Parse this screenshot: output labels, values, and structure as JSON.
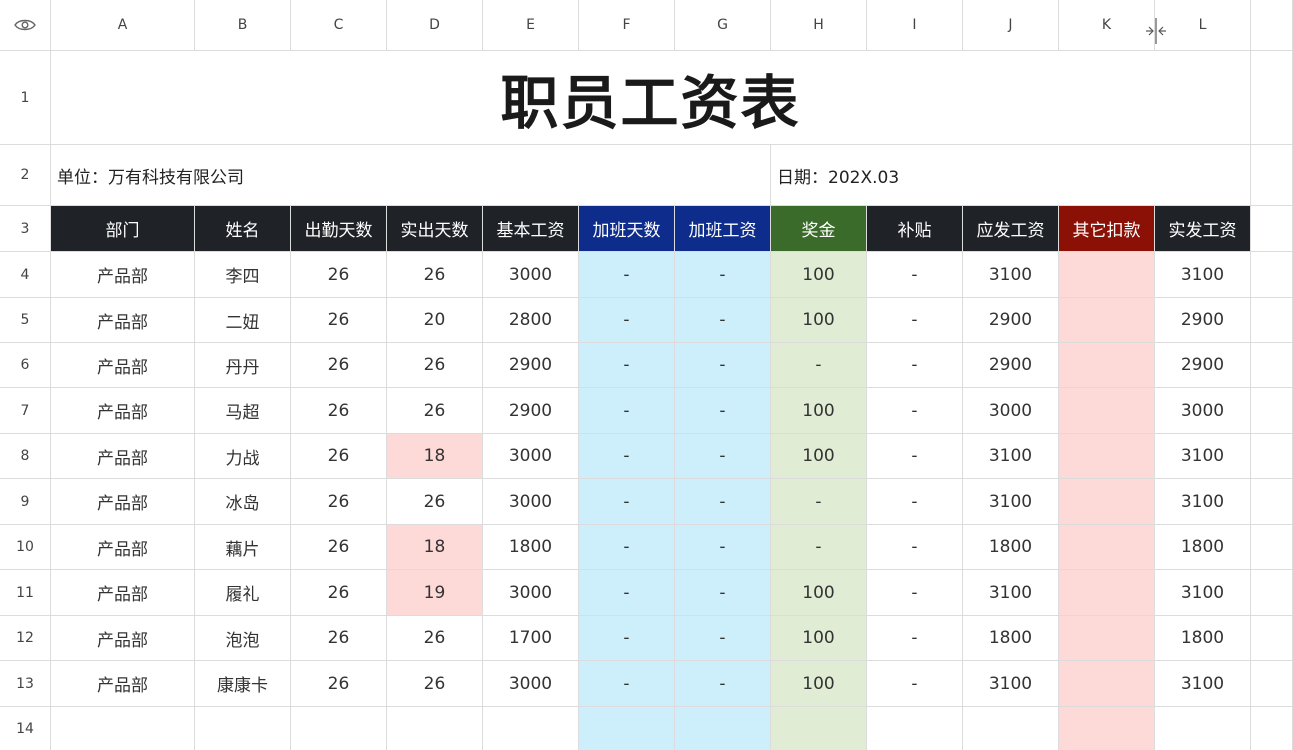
{
  "sheet": {
    "columns": [
      "A",
      "B",
      "C",
      "D",
      "E",
      "F",
      "G",
      "H",
      "I",
      "J",
      "K",
      "L"
    ],
    "rows": [
      "1",
      "2",
      "3",
      "4",
      "5",
      "6",
      "7",
      "8",
      "9",
      "10",
      "11",
      "12",
      "13",
      "14"
    ],
    "title": "职员工资表",
    "unit": "单位：万有科技有限公司",
    "date": "日期：202X.03",
    "headers": [
      "部门",
      "姓名",
      "出勤天数",
      "实出天数",
      "基本工资",
      "加班天数",
      "加班工资",
      "奖金",
      "补贴",
      "应发工资",
      "其它扣款",
      "实发工资"
    ],
    "records": [
      [
        "产品部",
        "李四",
        "26",
        "26",
        "3000",
        "-",
        "-",
        "100",
        "-",
        "3100",
        "",
        "3100"
      ],
      [
        "产品部",
        "二妞",
        "26",
        "20",
        "2800",
        "-",
        "-",
        "100",
        "-",
        "2900",
        "",
        "2900"
      ],
      [
        "产品部",
        "丹丹",
        "26",
        "26",
        "2900",
        "-",
        "-",
        "-",
        "-",
        "2900",
        "",
        "2900"
      ],
      [
        "产品部",
        "马超",
        "26",
        "26",
        "2900",
        "-",
        "-",
        "100",
        "-",
        "3000",
        "",
        "3000"
      ],
      [
        "产品部",
        "力战",
        "26",
        "18",
        "3000",
        "-",
        "-",
        "100",
        "-",
        "3100",
        "",
        "3100"
      ],
      [
        "产品部",
        "冰岛",
        "26",
        "26",
        "3000",
        "-",
        "-",
        "-",
        "-",
        "3100",
        "",
        "3100"
      ],
      [
        "产品部",
        "藕片",
        "26",
        "18",
        "1800",
        "-",
        "-",
        "-",
        "-",
        "1800",
        "",
        "1800"
      ],
      [
        "产品部",
        "履礼",
        "26",
        "19",
        "3000",
        "-",
        "-",
        "100",
        "-",
        "3100",
        "",
        "3100"
      ],
      [
        "产品部",
        "泡泡",
        "26",
        "26",
        "1700",
        "-",
        "-",
        "100",
        "-",
        "1800",
        "",
        "1800"
      ],
      [
        "产品部",
        "康康卡",
        "26",
        "26",
        "3000",
        "-",
        "-",
        "100",
        "-",
        "3100",
        "",
        "3100"
      ]
    ],
    "highlighted_cells": [
      [
        4,
        3
      ],
      [
        6,
        3
      ],
      [
        7,
        3
      ]
    ],
    "colors": {
      "header_dark": "#1f2328",
      "header_blue": "#0d2c8c",
      "header_green": "#3a6b2a",
      "header_red": "#8b1005",
      "fill_blue": "#cdeefb",
      "fill_green": "#e1ecd5",
      "fill_pink": "#fdd9d8"
    },
    "icons": {
      "corner": "eye-icon",
      "resize": "column-resize-icon"
    }
  }
}
